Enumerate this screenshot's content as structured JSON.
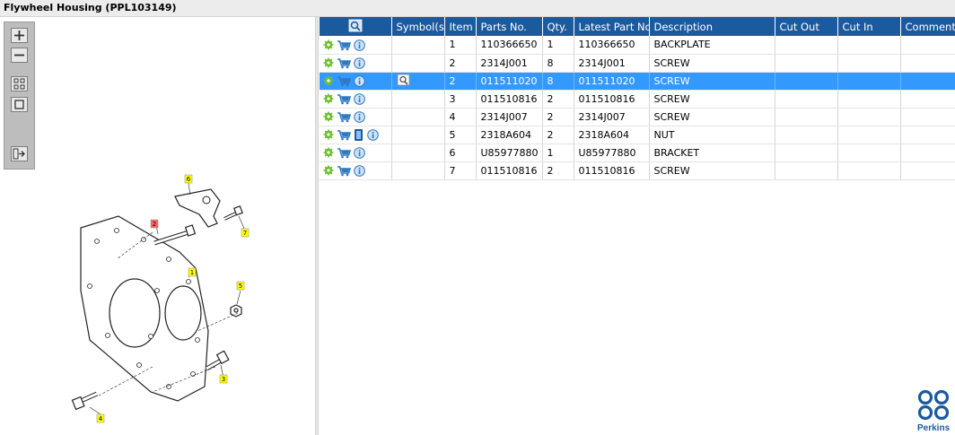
{
  "window": {
    "title": "Flywheel Housing (PPL103149)"
  },
  "table": {
    "columns": [
      "",
      "Symbol(s)",
      "Item",
      "Parts No.",
      "Qty.",
      "Latest Part No.",
      "Description",
      "Cut Out",
      "Cut In",
      "Comment"
    ],
    "rows": [
      {
        "item": "1",
        "part_no": "110366650",
        "qty": "1",
        "latest": "110366650",
        "desc": "BACKPLATE",
        "cut_out": "",
        "cut_in": "",
        "comment": "",
        "extra_icon": ""
      },
      {
        "item": "2",
        "part_no": "2314J001",
        "qty": "8",
        "latest": "2314J001",
        "desc": "SCREW",
        "cut_out": "",
        "cut_in": "",
        "comment": "",
        "extra_icon": ""
      },
      {
        "item": "2",
        "part_no": "011511020",
        "qty": "8",
        "latest": "011511020",
        "desc": "SCREW",
        "cut_out": "",
        "cut_in": "",
        "comment": "",
        "extra_icon": ""
      },
      {
        "item": "3",
        "part_no": "011510816",
        "qty": "2",
        "latest": "011510816",
        "desc": "SCREW",
        "cut_out": "",
        "cut_in": "",
        "comment": "",
        "extra_icon": ""
      },
      {
        "item": "4",
        "part_no": "2314J007",
        "qty": "2",
        "latest": "2314J007",
        "desc": "SCREW",
        "cut_out": "",
        "cut_in": "",
        "comment": "",
        "extra_icon": ""
      },
      {
        "item": "5",
        "part_no": "2318A604",
        "qty": "2",
        "latest": "2318A604",
        "desc": "NUT",
        "cut_out": "",
        "cut_in": "",
        "comment": "",
        "extra_icon": "document-icon"
      },
      {
        "item": "6",
        "part_no": "U85977880",
        "qty": "1",
        "latest": "U85977880",
        "desc": "BRACKET",
        "cut_out": "",
        "cut_in": "",
        "comment": "",
        "extra_icon": ""
      },
      {
        "item": "7",
        "part_no": "011510816",
        "qty": "2",
        "latest": "011510816",
        "desc": "SCREW",
        "cut_out": "",
        "cut_in": "",
        "comment": "",
        "extra_icon": ""
      }
    ],
    "selected_row_index": 2
  },
  "diagram": {
    "callouts": [
      {
        "label": "1",
        "color": "#ffff00"
      },
      {
        "label": "2",
        "color": "#ff6666"
      },
      {
        "label": "3",
        "color": "#ffff00"
      },
      {
        "label": "4",
        "color": "#ffff00"
      },
      {
        "label": "5",
        "color": "#ffff00"
      },
      {
        "label": "6",
        "color": "#ffff00"
      },
      {
        "label": "7",
        "color": "#ffff00"
      }
    ]
  },
  "toolbar": {
    "tools": [
      "zoom-in-icon",
      "zoom-out-icon",
      "fit-page-icon",
      "actual-size-icon",
      "export-icon"
    ]
  },
  "logo": {
    "text": "Perkins"
  },
  "colors": {
    "header": "#1c5a9e",
    "selected": "#3399ff",
    "callout_yellow": "#ffff00",
    "callout_red": "#ff6666"
  }
}
